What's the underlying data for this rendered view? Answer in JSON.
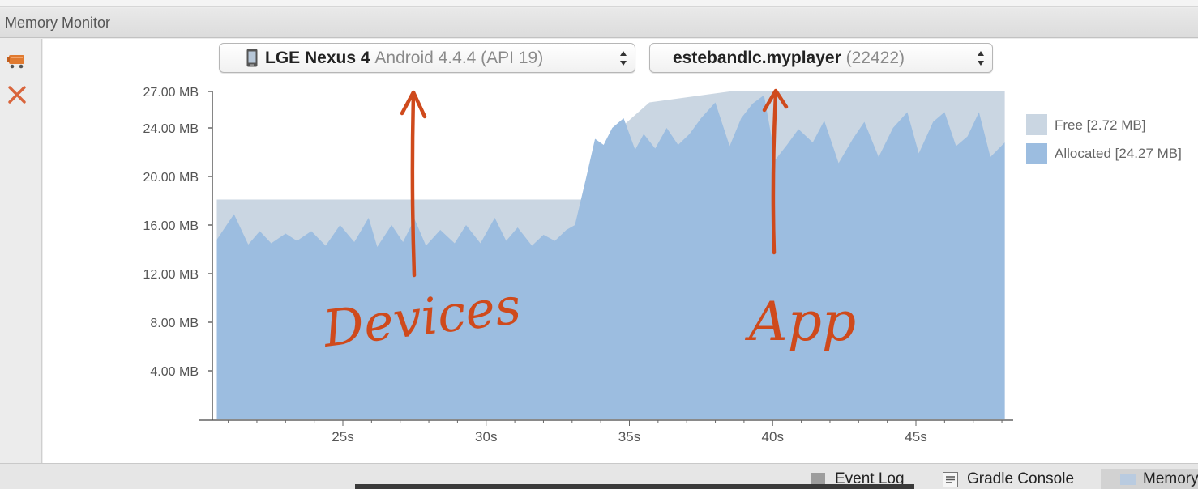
{
  "window": {
    "title": "Memory Monitor"
  },
  "toolbar": [
    {
      "name": "gc-icon",
      "color": "#e07a30"
    },
    {
      "name": "close-icon",
      "color": "#d9653c"
    }
  ],
  "device_selector": {
    "device": "LGE Nexus 4",
    "os": "Android 4.4.4 (API 19)"
  },
  "app_selector": {
    "package": "estebandlc.myplayer",
    "pid": "(22422)"
  },
  "colors": {
    "free": "#cad6e2",
    "allocated": "#9cbde0",
    "annotation": "#cf4a1c"
  },
  "annotations": [
    {
      "text": "Devices"
    },
    {
      "text": "App"
    }
  ],
  "legend": [
    {
      "label": "Free [2.72 MB]",
      "color": "#cad6e2"
    },
    {
      "label": "Allocated [24.27 MB]",
      "color": "#9cbde0"
    }
  ],
  "chart_data": {
    "type": "area",
    "unit": "MB",
    "y_tick_labels": [
      "27.00 MB",
      "24.00 MB",
      "20.00 MB",
      "16.00 MB",
      "12.00 MB",
      "8.00 MB",
      "4.00 MB"
    ],
    "y_ticks": [
      27,
      24,
      20,
      16,
      12,
      8,
      4
    ],
    "ylim": [
      0,
      27
    ],
    "x_tick_labels": [
      "25s",
      "30s",
      "35s",
      "40s",
      "45s"
    ],
    "x_ticks": [
      25,
      30,
      35,
      40,
      45
    ],
    "xlim": [
      20.5,
      48.7
    ],
    "series": [
      {
        "name": "Free",
        "x": [
          20.6,
          33.6,
          34.5,
          35.7,
          38.5,
          48.1
        ],
        "values": [
          18.1,
          18.1,
          23.6,
          26.1,
          27.0,
          27.0
        ]
      },
      {
        "name": "Allocated",
        "x": [
          20.6,
          21.2,
          21.7,
          22.1,
          22.5,
          23.0,
          23.4,
          23.9,
          24.4,
          24.9,
          25.4,
          25.9,
          26.2,
          26.7,
          27.1,
          27.5,
          27.9,
          28.4,
          28.9,
          29.3,
          29.8,
          30.3,
          30.7,
          31.1,
          31.6,
          32.0,
          32.4,
          32.8,
          33.1,
          33.5,
          33.8,
          34.1,
          34.4,
          34.8,
          35.2,
          35.5,
          35.9,
          36.3,
          36.7,
          37.1,
          37.5,
          38.0,
          38.5,
          38.9,
          39.3,
          39.7,
          40.1,
          40.5,
          40.9,
          41.4,
          41.8,
          42.3,
          42.8,
          43.2,
          43.7,
          44.2,
          44.7,
          45.1,
          45.6,
          46.0,
          46.4,
          46.8,
          47.2,
          47.6,
          48.1
        ],
        "values": [
          14.8,
          16.9,
          14.4,
          15.5,
          14.5,
          15.3,
          14.7,
          15.5,
          14.3,
          16.0,
          14.6,
          16.6,
          14.2,
          16.0,
          14.6,
          16.5,
          14.3,
          15.6,
          14.5,
          16.0,
          14.5,
          16.6,
          14.7,
          15.8,
          14.3,
          15.2,
          14.7,
          15.6,
          16.0,
          20.0,
          23.1,
          22.6,
          24.0,
          24.8,
          22.2,
          23.5,
          22.3,
          24.0,
          22.6,
          23.5,
          24.8,
          26.1,
          22.5,
          24.8,
          26.0,
          26.7,
          21.4,
          22.6,
          23.9,
          22.8,
          24.6,
          21.1,
          23.1,
          24.5,
          21.6,
          24.0,
          25.3,
          21.9,
          24.5,
          25.3,
          22.5,
          23.3,
          25.3,
          21.6,
          22.8
        ]
      }
    ]
  },
  "statusbar": {
    "items": [
      "Event Log",
      "Gradle Console",
      "Memory"
    ]
  }
}
